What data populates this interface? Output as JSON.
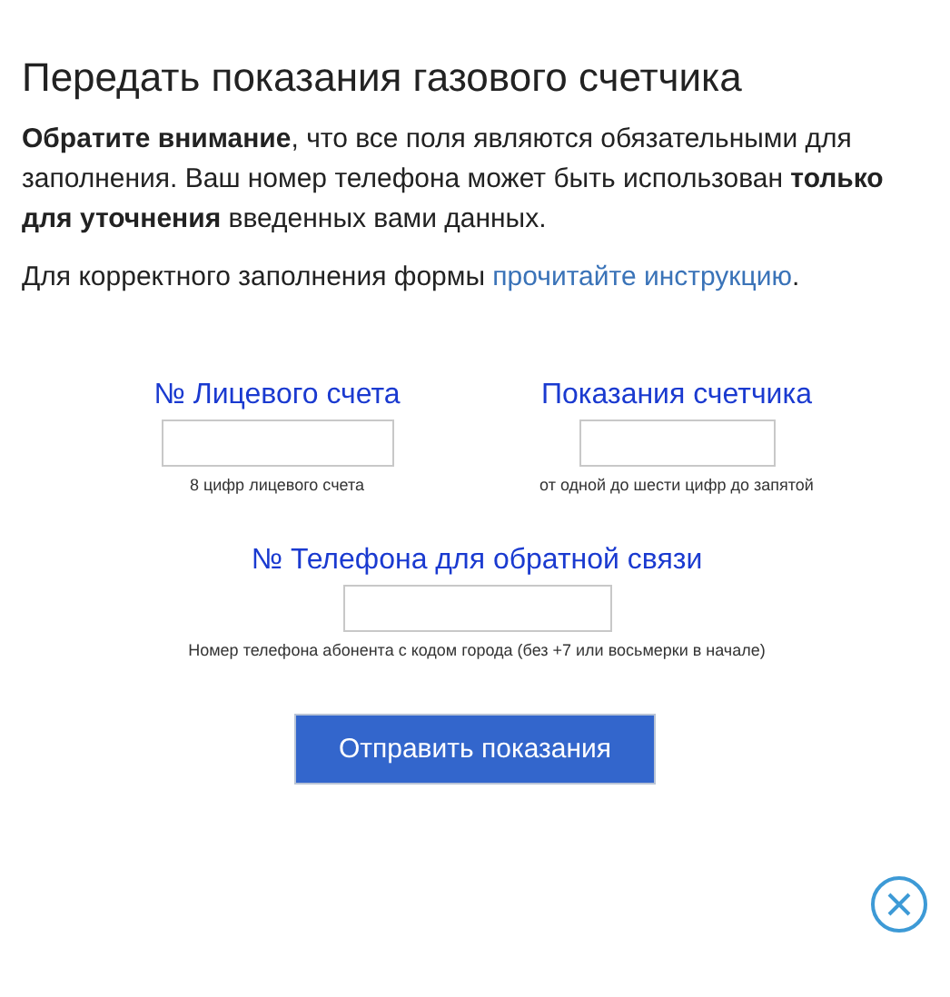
{
  "title": "Передать показания газового счетчика",
  "notice": "**Обратите внимание**, что все поля являются обязательными для заполнения. Ваш номер телефона может быть использован **только для уточнения** введенных вами данных.",
  "instruction": {
    "text": "Для корректного заполнения формы",
    "link": "прочитайте инструкцию",
    "after": "."
  },
  "fields": [
    {
      "label": "№ Лицевого счета",
      "hint": "8 цифр лицевого счета"
    },
    {
      "label": "Показания счетчика",
      "hint": "от одной до шести цифр до запятой"
    },
    {
      "label": "№ Телефона для обратной связи",
      "hint": "Номер телефона абонента с кодом города (без +7 или восьмерки в начале)"
    }
  ],
  "submit": "Отправить показания"
}
